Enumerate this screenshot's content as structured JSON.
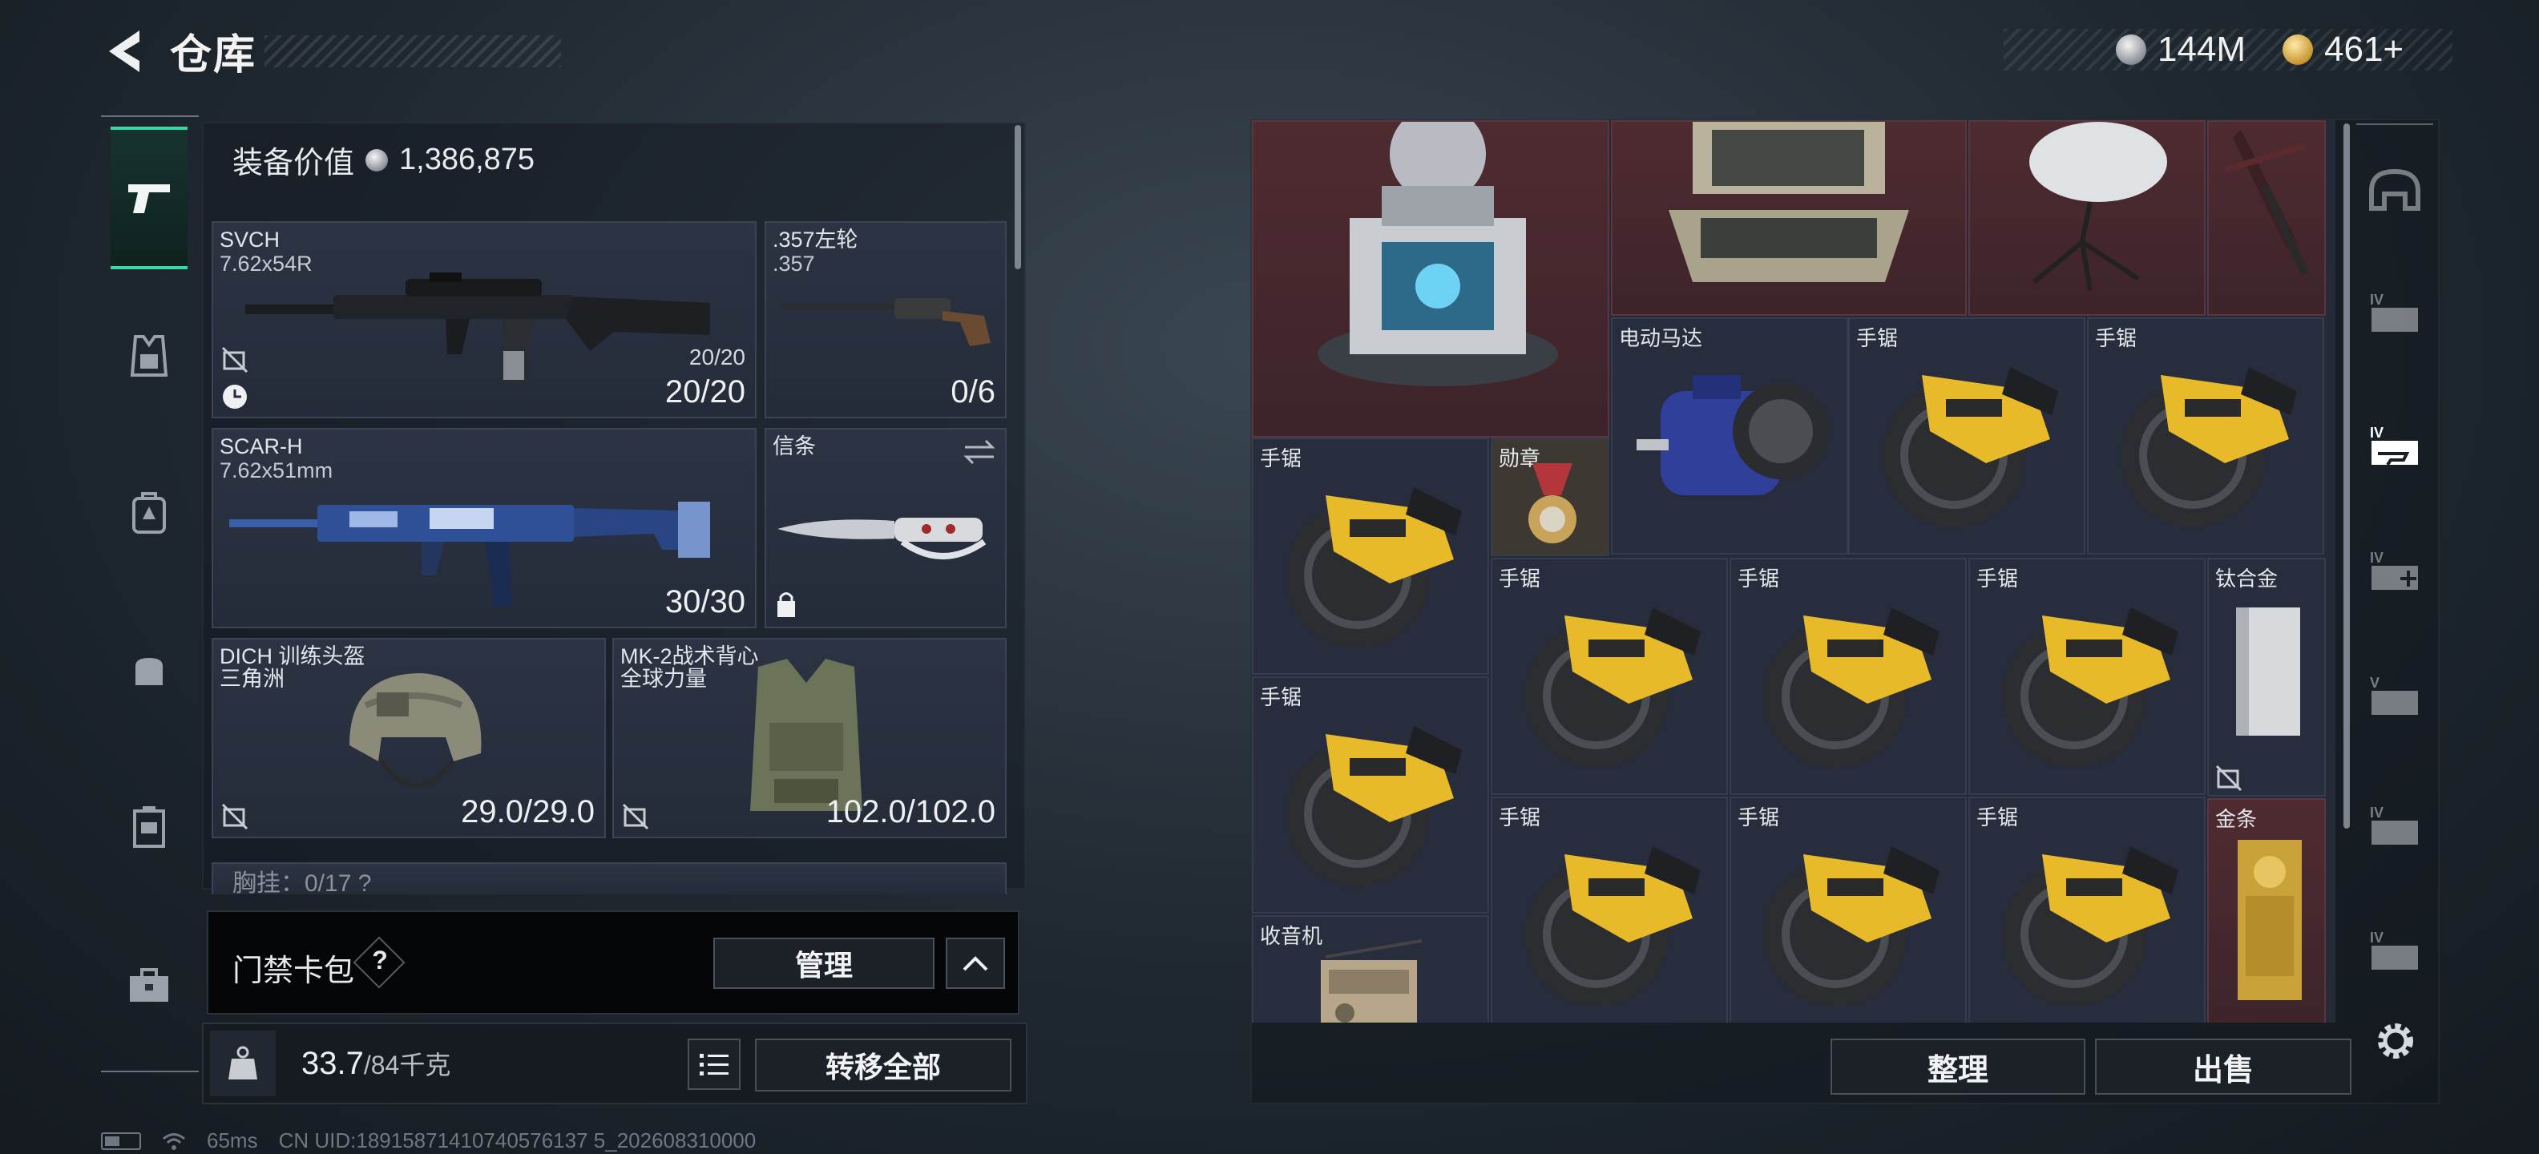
{
  "header": {
    "title": "仓库",
    "currency_silver": "144M",
    "currency_gold": "461+"
  },
  "sidebar": {
    "tabs": [
      {
        "name": "weapon",
        "icon": "pistol-icon",
        "active": true
      },
      {
        "name": "armor",
        "icon": "armor-rig-icon"
      },
      {
        "name": "backpack",
        "icon": "backpack-icon"
      },
      {
        "name": "bag",
        "icon": "pouch-icon"
      },
      {
        "name": "case",
        "icon": "case-icon"
      },
      {
        "name": "briefcase",
        "icon": "briefcase-icon"
      }
    ]
  },
  "loadout": {
    "equip_value_label": "装备价值",
    "equip_value": "1,386,875",
    "slots": {
      "svch": {
        "name": "SVCH",
        "ammo": "7.62x54R",
        "small": "20/20",
        "count": "20/20"
      },
      "revolver": {
        "name": ".357左轮",
        "ammo": ".357",
        "count": "0/6"
      },
      "scar": {
        "name": "SCAR-H",
        "ammo": "7.62x51mm",
        "count": "30/30"
      },
      "xintiao": {
        "name": "信条"
      },
      "helmet": {
        "name": "DICH 训练头盔",
        "sub": "三角洲",
        "count": "29.0/29.0"
      },
      "vest": {
        "name": "MK-2战术背心",
        "sub": "全球力量",
        "count": "102.0/102.0"
      },
      "chest": {
        "name": "胸挂：0/17 ?"
      }
    },
    "access_card": {
      "label": "门禁卡包",
      "help": "?",
      "manage": "管理"
    },
    "weight": {
      "current": "33.7",
      "max": "/84千克"
    },
    "transfer_all": "转移全部"
  },
  "stash": {
    "items": {
      "generator": {
        "label": ""
      },
      "case": {
        "label": ""
      },
      "dish": {
        "label": ""
      },
      "crossbow": {
        "label": ""
      },
      "motor": {
        "label": "电动马达"
      },
      "saw": {
        "label": "手锯"
      },
      "medal": {
        "label": "勋章"
      },
      "titanium": {
        "label": "钛合金"
      },
      "gold": {
        "label": "金条"
      },
      "radio": {
        "label": "收音机"
      }
    },
    "sort": "整理",
    "sell": "出售"
  },
  "right_tabs": [
    {
      "icon": "helmet-side-icon",
      "active": false
    },
    {
      "icon": "crate-iv-icon",
      "active": false
    },
    {
      "icon": "weapon-crate-iv-icon",
      "active": true
    },
    {
      "icon": "medkit-iv-icon",
      "active": false
    },
    {
      "icon": "ammo-v-icon",
      "active": false
    },
    {
      "icon": "crate-iv-2-icon",
      "active": false
    },
    {
      "icon": "crate-iv-3-icon",
      "active": false
    }
  ],
  "status": {
    "ping": "65ms",
    "uid": "CN UID:18915871410740576137 5_202608310000"
  }
}
